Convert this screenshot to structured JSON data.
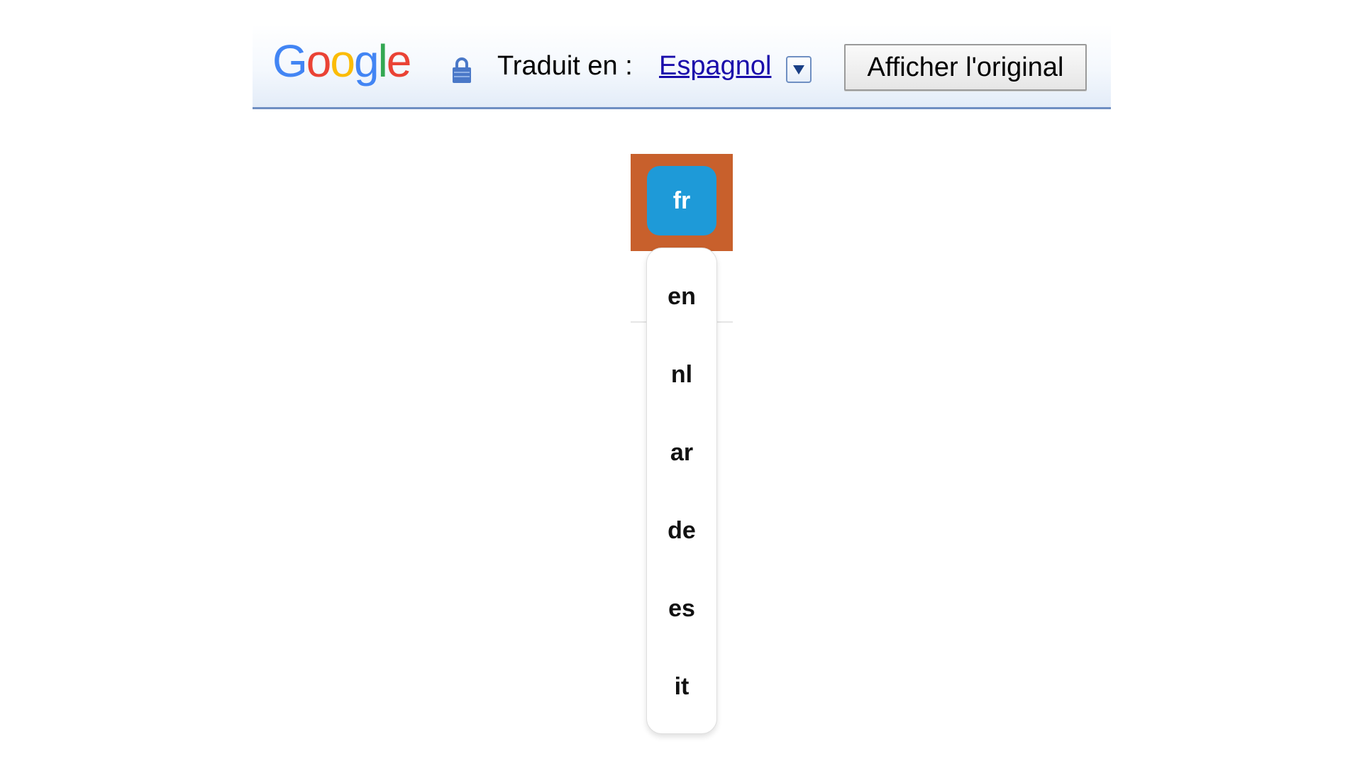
{
  "translate_bar": {
    "logo": {
      "letters": [
        "G",
        "o",
        "o",
        "g",
        "l",
        "e"
      ],
      "colors": [
        "#4285f4",
        "#ea4335",
        "#fbbc05",
        "#4285f4",
        "#34a853",
        "#ea4335"
      ]
    },
    "lock_icon": "lock-icon",
    "translated_label": "Traduit en :",
    "language": "Espagnol",
    "dropdown_icon": "triangle-down-icon",
    "show_original_label": "Afficher l'original",
    "border_color": "#6f8fc2"
  },
  "lang_switcher": {
    "current": "fr",
    "frame_color": "#c8602c",
    "button_color": "#1e9ad8",
    "options": [
      "en",
      "nl",
      "ar",
      "de",
      "es",
      "it"
    ]
  }
}
